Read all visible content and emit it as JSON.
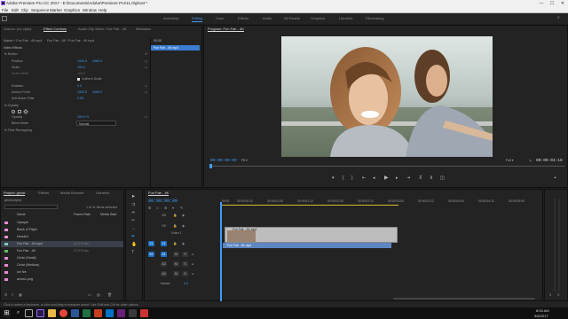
{
  "window": {
    "title": "Adobe Premiere Pro CC 2017 - E:\\Documents\\Adobe\\Premiere Pro\\11.0\\ghost *",
    "minimize": "—",
    "maximize": "☐",
    "close": "✕"
  },
  "menu": [
    "File",
    "Edit",
    "Clip",
    "Sequence",
    "Marker",
    "Graphics",
    "Window",
    "Help"
  ],
  "workspaces": [
    "Assembly",
    "Editing",
    "Color",
    "Effects",
    "Audio",
    "All Panels",
    "Graphics",
    "Libraries",
    "Filmmaking"
  ],
  "workspace_active": "Editing",
  "source_tabs": [
    "Source: (no clips)",
    "Effect Controls",
    "Audio Clip Mixer: Fun Fair - 4K",
    "Metadata"
  ],
  "effect_controls": {
    "clip_path": "Master * Fun Fair - 4K.mp4",
    "sequence_path": "Fun Fair - 4K * Fun Fair - 4K.mp4",
    "clip_label": "Fun Fair - 4K.mp4",
    "timecode": "00:00",
    "section": "Video Effects",
    "rows": [
      {
        "name": "fx  Motion"
      },
      {
        "name": "Position",
        "v1": "1920.0",
        "v2": "1080.0"
      },
      {
        "name": "Scale",
        "v1": "100.0"
      },
      {
        "name": "Scale Width",
        "v1": "100.0"
      },
      {
        "name": "",
        "v1": "Uniform Scale"
      },
      {
        "name": "Rotation",
        "v1": "0.0"
      },
      {
        "name": "Anchor Point",
        "v1": "1920.0",
        "v2": "1080.0"
      },
      {
        "name": "Anti-flicker Filter",
        "v1": "0.00"
      },
      {
        "name": "fx  Opacity"
      },
      {
        "name": "Opacity",
        "v1": "100.0 %"
      },
      {
        "name": "Blend Mode",
        "v1": "Normal"
      },
      {
        "name": "fx  Time Remapping"
      }
    ]
  },
  "program": {
    "tab": "Program: Fun Fair - 4K",
    "timecode_left": "00:00:00:00",
    "fit": "Fit",
    "quality": "Full",
    "timecode_right": "00:00:03:18"
  },
  "project": {
    "tabs": [
      "Project: ghost",
      "Effects",
      "Media Browser",
      "Libraries"
    ],
    "file": "ghost.prproj",
    "selection": "1 of 11 items selected",
    "columns": [
      "Name",
      "Frame Rate",
      "Media Start"
    ],
    "items": [
      {
        "name": "Opaque",
        "color": "#e48bd2",
        "fps": ""
      },
      {
        "name": "Black of Flight",
        "color": "#e48bd2",
        "fps": ""
      },
      {
        "name": "Headed",
        "color": "#e48bd2",
        "fps": ""
      },
      {
        "name": "Fun Fair - 4K.mp4",
        "color": "#7bc7b7",
        "fps": "23.976 fps",
        "selected": true
      },
      {
        "name": "Fun Fair - 4K",
        "color": "#5fb85f",
        "fps": "23.976 fps"
      },
      {
        "name": "Circle (Small)",
        "color": "#e48bd2",
        "fps": ""
      },
      {
        "name": "Circle (Medium)",
        "color": "#e48bd2",
        "fps": ""
      },
      {
        "name": "Ice fire",
        "color": "#e48bd2",
        "fps": ""
      },
      {
        "name": "arrow1.png",
        "color": "#e48bd2",
        "fps": ""
      }
    ]
  },
  "timeline": {
    "tab": "Fun Fair - 4K",
    "timecode": "00:00:00:00",
    "ruler": [
      ":00:00",
      "00:00:00:12",
      "00:00:01:00",
      "00:00:01:12",
      "00:00:02:00",
      "00:00:02:12",
      "00:00:03:00",
      "00:00:03:12",
      "00:00:04:00",
      "00:00:04:12",
      "00:00:05:00"
    ],
    "video_tracks": [
      "V3",
      "V2",
      "V1"
    ],
    "audio_tracks": [
      "A1",
      "A2",
      "A3"
    ],
    "clip_v2": "Fun Fair - 4K.mp4",
    "clip_v1": "Fun Fair - 4K.mp4",
    "clip_v2_label": "Video 1",
    "master": "Master",
    "master_val": "0.0"
  },
  "status": "Click to select a keyframe, or click and drag to marquee select. Use Shift and Ctrl for other options.",
  "taskbar": {
    "time": "8:53 AM",
    "date": "9/6/2017",
    "icons": [
      "windows",
      "search",
      "task-view",
      "premiere",
      "file-explorer",
      "chrome",
      "word",
      "excel",
      "powerpoint",
      "outlook",
      "visual-studio",
      "unknown",
      "media"
    ]
  },
  "accent": "#3e9cf3"
}
